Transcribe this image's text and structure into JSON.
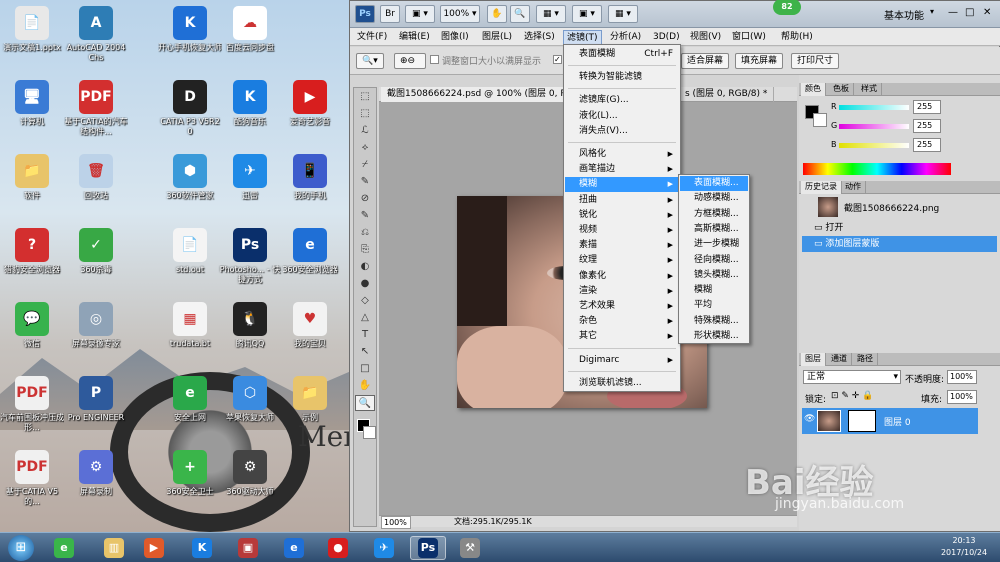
{
  "desktop": {
    "icons": [
      {
        "label": "演示文稿1.pptx",
        "color": "#e8e8e8",
        "glyph": "📄"
      },
      {
        "label": "AutoCAD 2004 Chs",
        "color": "#2e7db5",
        "glyph": "A"
      },
      {
        "label": "开心手机恢复大师",
        "color": "#1f6fd6",
        "glyph": "K"
      },
      {
        "label": "百度云同步盘",
        "color": "#ffffff",
        "glyph": "☁"
      },
      {
        "label": "计算机",
        "color": "#3a7bd5",
        "glyph": "🖥"
      },
      {
        "label": "基于CATIA的汽车结构件...",
        "color": "#d32f2f",
        "glyph": "PDF"
      },
      {
        "label": "CATIA P3 V5R20",
        "color": "#222222",
        "glyph": "D"
      },
      {
        "label": "酷狗音乐",
        "color": "#1a7de0",
        "glyph": "K"
      },
      {
        "label": "爱奇艺影音",
        "color": "#d81e1e",
        "glyph": "▶"
      },
      {
        "label": "软件",
        "color": "#e8c46a",
        "glyph": "📁"
      },
      {
        "label": "回收站",
        "color": "#bcd2e8",
        "glyph": "🗑"
      },
      {
        "label": "360软件管家",
        "color": "#3a9ad9",
        "glyph": "⬢"
      },
      {
        "label": "迅雷",
        "color": "#1f8ae6",
        "glyph": "✈"
      },
      {
        "label": "我的手机",
        "color": "#3d5ccc",
        "glyph": "📱"
      },
      {
        "label": "猎豹安全浏览器",
        "color": "#d32f2f",
        "glyph": "?"
      },
      {
        "label": "360杀毒",
        "color": "#38a845",
        "glyph": "✓"
      },
      {
        "label": "std.out",
        "color": "#f4f4f4",
        "glyph": "📄"
      },
      {
        "label": "Photosho... - 快捷方式",
        "color": "#0a2f6b",
        "glyph": "Ps"
      },
      {
        "label": "360安全浏览器",
        "color": "#1f6fd6",
        "glyph": "e"
      },
      {
        "label": "微信",
        "color": "#37b24d",
        "glyph": "💬"
      },
      {
        "label": "屏幕录像专家",
        "color": "#8fa3b7",
        "glyph": "◎"
      },
      {
        "label": "trudata.bt",
        "color": "#f4f4f4",
        "glyph": "▦"
      },
      {
        "label": "腾讯QQ",
        "color": "#222222",
        "glyph": "🐧"
      },
      {
        "label": "我的宝贝",
        "color": "#f2f2f2",
        "glyph": "♥"
      },
      {
        "label": "汽车前围板冲压成形...",
        "color": "#f0f0f0",
        "glyph": "PDF"
      },
      {
        "label": "Pro ENGINEER",
        "color": "#2e5a9c",
        "glyph": "P"
      },
      {
        "label": "安全上网",
        "color": "#2aa84a",
        "glyph": "e"
      },
      {
        "label": "苹果恢复大师",
        "color": "#3a8be0",
        "glyph": "⬡"
      },
      {
        "label": "示例",
        "color": "#e8c46a",
        "glyph": "📁"
      },
      {
        "label": "基于CATIA V5的...",
        "color": "#f0f0f0",
        "glyph": "PDF"
      },
      {
        "label": "屏幕录制",
        "color": "#5b6fd6",
        "glyph": "⚙"
      },
      {
        "label": "360安全卫士",
        "color": "#3ab54a",
        "glyph": "+"
      },
      {
        "label": "360驱动大师",
        "color": "#444444",
        "glyph": "⚙"
      }
    ],
    "wallpaper_text": "Mer"
  },
  "ps": {
    "app_buttons": [
      "Ps",
      "Br",
      "▣ ▾",
      "100% ▾",
      "✋",
      "🔍",
      "▦ ▾",
      "▣ ▾",
      "▦ ▾"
    ],
    "workspace": "基本功能",
    "badge": "82",
    "window_controls": [
      "—",
      "□",
      "✕"
    ],
    "menus": [
      "文件(F)",
      "编辑(E)",
      "图像(I)",
      "图层(L)",
      "选择(S)",
      "滤镜(T)",
      "分析(A)",
      "3D(D)",
      "视图(V)",
      "窗口(W)",
      "帮助(H)"
    ],
    "options": {
      "resize_checkbox": "调整窗口大小以满屏显示",
      "buttons": [
        "适合屏幕",
        "填充屏幕",
        "打印尺寸"
      ]
    },
    "doc_tab": "截图1508666224.psd @ 100% (图层 0, RGB/8) *",
    "doc_tab_2": "s (图层 0, RGB/8) *",
    "status_zoom": "100%",
    "status_doc": "文档:295.1K/295.1K",
    "tools": [
      "⬚",
      "⬚",
      "ℒ",
      "⟡",
      "⌿",
      "✎",
      "⊘",
      "✎",
      "⎌",
      "⎘",
      "◐",
      "●",
      "◇",
      "△",
      "T",
      "↖",
      "□",
      "✋",
      "🔍"
    ],
    "color_panel": {
      "tabs": [
        "颜色",
        "色板",
        "样式"
      ],
      "channels": [
        {
          "name": "R",
          "value": "255",
          "color": "#00e0e0"
        },
        {
          "name": "G",
          "value": "255",
          "color": "#e000e0"
        },
        {
          "name": "B",
          "value": "255",
          "color": "#e0e000"
        }
      ]
    },
    "history_panel": {
      "tabs": [
        "历史记录",
        "动作"
      ],
      "snapshot": "截图1508666224.png",
      "items": [
        "打开",
        "添加图层蒙版"
      ]
    },
    "layers_panel": {
      "tabs": [
        "图层",
        "通道",
        "路径"
      ],
      "blend_mode": "正常",
      "opacity_label": "不透明度:",
      "opacity": "100%",
      "lock_label": "锁定:",
      "fill_label": "填充:",
      "fill": "100%",
      "layer_name": "图层 0"
    }
  },
  "filter_menu": {
    "items": [
      {
        "label": "表面模糊",
        "shortcut": "Ctrl+F"
      },
      {
        "label": "转换为智能滤镜"
      },
      {
        "label": "滤镜库(G)..."
      },
      {
        "label": "液化(L)..."
      },
      {
        "label": "消失点(V)..."
      },
      {
        "label": "风格化",
        "sub": true
      },
      {
        "label": "画笔描边",
        "sub": true
      },
      {
        "label": "模糊",
        "sub": true
      },
      {
        "label": "扭曲",
        "sub": true
      },
      {
        "label": "锐化",
        "sub": true
      },
      {
        "label": "视频",
        "sub": true
      },
      {
        "label": "素描",
        "sub": true
      },
      {
        "label": "纹理",
        "sub": true
      },
      {
        "label": "像素化",
        "sub": true
      },
      {
        "label": "渲染",
        "sub": true
      },
      {
        "label": "艺术效果",
        "sub": true
      },
      {
        "label": "杂色",
        "sub": true
      },
      {
        "label": "其它",
        "sub": true
      },
      {
        "label": "Digimarc",
        "sub": true
      },
      {
        "label": "浏览联机滤镜..."
      }
    ],
    "blur_submenu": [
      "表面模糊...",
      "动感模糊...",
      "方框模糊...",
      "高斯模糊...",
      "进一步模糊",
      "径向模糊...",
      "镜头模糊...",
      "模糊",
      "平均",
      "特殊模糊...",
      "形状模糊..."
    ]
  },
  "taskbar": {
    "start": "⊞",
    "apps": [
      {
        "name": "360",
        "color": "#3ab54a",
        "glyph": "e"
      },
      {
        "name": "explorer",
        "color": "#e8c46a",
        "glyph": "▥"
      },
      {
        "name": "player",
        "color": "#e05a2a",
        "glyph": "▶"
      },
      {
        "name": "kugou",
        "color": "#1a7de0",
        "glyph": "K"
      },
      {
        "name": "app",
        "color": "#b73a3a",
        "glyph": "▣"
      },
      {
        "name": "ie",
        "color": "#1f6fd6",
        "glyph": "e"
      },
      {
        "name": "aiqiyi",
        "color": "#d81e1e",
        "glyph": "●"
      },
      {
        "name": "xunlei",
        "color": "#1f8ae6",
        "glyph": "✈"
      },
      {
        "name": "photoshop",
        "color": "#0a2f6b",
        "glyph": "Ps"
      },
      {
        "name": "tools",
        "color": "#888888",
        "glyph": "⚒"
      }
    ],
    "time": "20:13",
    "date": "2017/10/24"
  },
  "watermark": {
    "logo": "Bai经验",
    "url": "jingyan.baidu.com"
  }
}
